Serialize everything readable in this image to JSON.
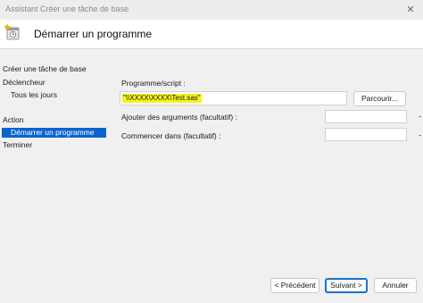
{
  "window": {
    "title": "Assistant Créer une tâche de base",
    "close_glyph": "✕"
  },
  "header": {
    "title": "Démarrer un programme",
    "icon": "task-wizard-icon"
  },
  "steps": {
    "create_task": "Créer une tâche de base",
    "trigger": "Déclencheur",
    "daily": "Tous les jours",
    "action": "Action",
    "start_program": "Démarrer un programme",
    "finish": "Terminer"
  },
  "form": {
    "program_label": "Programme/script :",
    "program_value": "\"\\\\XXXX\\XXXX\\Test.sas\"",
    "browse_label": "Parcourir...",
    "arguments_label": "Ajouter des arguments (facultatif) :",
    "arguments_value": "",
    "start_in_label": "Commencer dans (facultatif) :",
    "start_in_value": ""
  },
  "footer": {
    "previous_label": "< Précédent",
    "next_label": "Suivant >",
    "cancel_label": "Annuler"
  },
  "colors": {
    "selection": "#0a64d0",
    "highlight": "#f4f41a",
    "primary_border": "#1a73c9"
  }
}
